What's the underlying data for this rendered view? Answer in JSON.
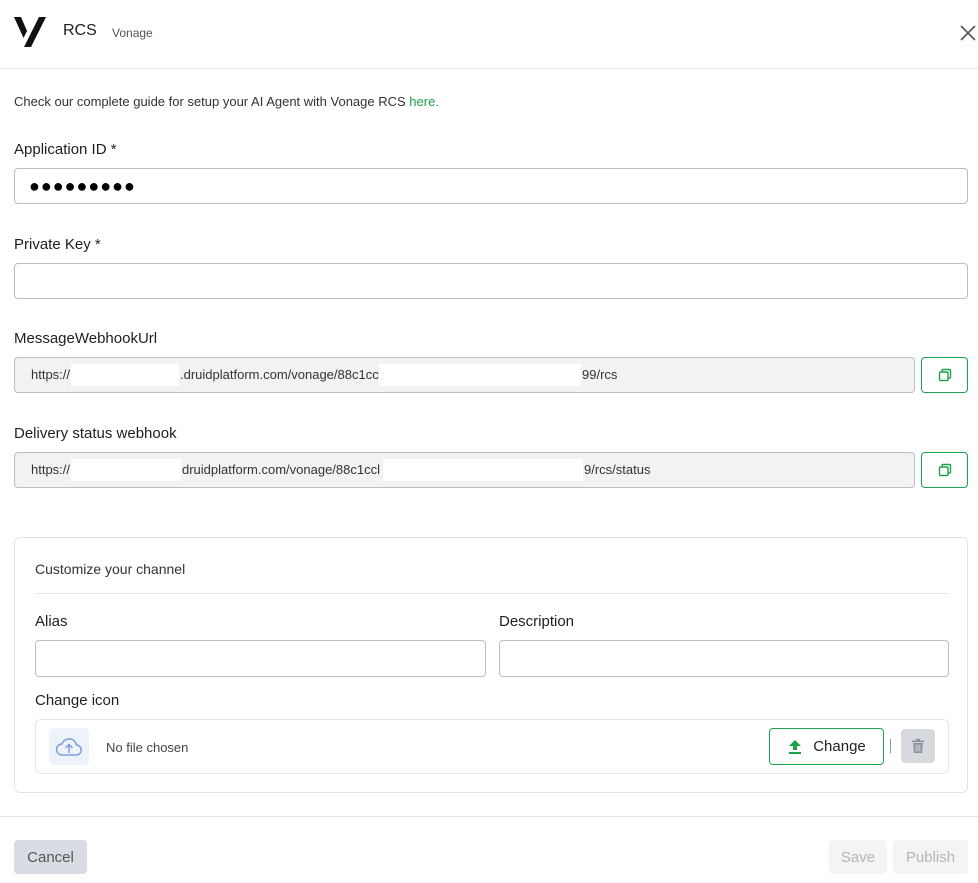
{
  "header": {
    "logo_icon": "vonage-logo-icon",
    "title": "RCS",
    "subtitle": "Vonage",
    "close_icon": "close-icon"
  },
  "guide": {
    "text": "Check our complete guide for setup your AI Agent with Vonage RCS ",
    "link": "here."
  },
  "fields": {
    "application_id": {
      "label": "Application ID *",
      "value": "●●●●●●●●●"
    },
    "private_key": {
      "label": "Private Key *",
      "value": ""
    },
    "message_webhook": {
      "label": "MessageWebhookUrl",
      "part1": "https://",
      "part2": ".druidplatform.com/vonage/88c1cc",
      "part3": "99/rcs"
    },
    "delivery_webhook": {
      "label": "Delivery status webhook",
      "part1": "https://",
      "part2": "druidplatform.com/vonage/88c1ccl",
      "part3": "9/rcs/status"
    }
  },
  "customize": {
    "title": "Customize your channel",
    "alias_label": "Alias",
    "description_label": "Description",
    "change_icon_label": "Change icon",
    "file_text": "No file chosen",
    "change_button": "Change",
    "sep": "|"
  },
  "footer": {
    "cancel": "Cancel",
    "save": "Save",
    "publish": "Publish"
  },
  "colors": {
    "accent": "#1aa34a",
    "link": "#1aa34a",
    "disabled_text": "#b5b5b5"
  }
}
